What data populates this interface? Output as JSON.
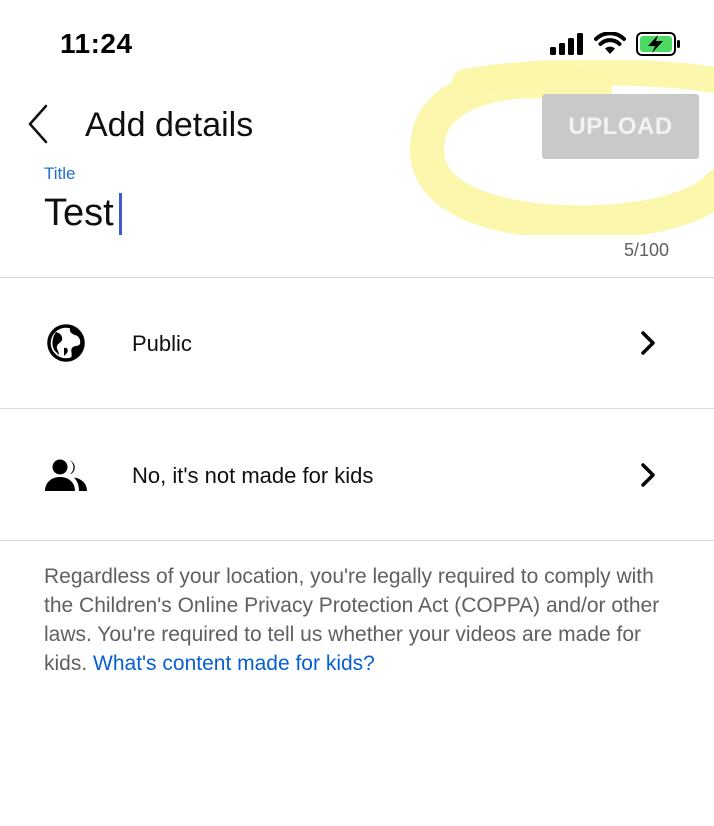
{
  "status_bar": {
    "time": "11:24",
    "icons": [
      "cellular-signal-icon",
      "wifi-icon",
      "battery-charging-icon"
    ]
  },
  "header": {
    "title": "Add details",
    "back_icon": "chevron-left-icon",
    "upload_label": "UPLOAD"
  },
  "title_field": {
    "label": "Title",
    "value": "Test",
    "char_count": "5/100"
  },
  "settings": [
    {
      "icon": "globe-icon",
      "label": "Public",
      "chevron": "chevron-right-icon"
    },
    {
      "icon": "people-icon",
      "label": "No, it's not made for kids",
      "chevron": "chevron-right-icon"
    }
  ],
  "disclaimer": {
    "text": "Regardless of your location, you're legally required to comply with the Children's Online Privacy Protection Act (COPPA) and/or other laws. You're required to tell us whether your videos are made for kids.",
    "link_text": "What's content made for kids?"
  },
  "colors": {
    "accent_blue": "#065fd4",
    "label_blue": "#1d6fd0",
    "upload_disabled": "#c9c9c9",
    "highlight_yellow": "#fbf7a8"
  }
}
